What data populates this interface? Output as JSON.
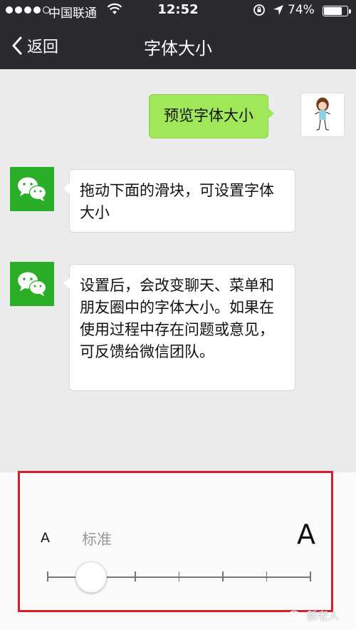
{
  "status_bar": {
    "carrier": "中国联通",
    "time": "12:52",
    "battery_text": "74%",
    "battery_level": 0.74,
    "signal_dots_filled": 4,
    "signal_dots_total": 5
  },
  "nav": {
    "back_label": "返回",
    "title": "字体大小"
  },
  "chat": {
    "messages": [
      {
        "side": "right",
        "text": "预览字体大小",
        "avatar": "user-avatar"
      },
      {
        "side": "left",
        "text": "拖动下面的滑块，可设置字体大小",
        "avatar": "wechat-logo-icon"
      },
      {
        "side": "left",
        "text": "设置后，会改变聊天、菜单和朋友圈中的字体大小。如果在使用过程中存在问题或意见，可反馈给微信团队。",
        "avatar": "wechat-logo-icon"
      }
    ]
  },
  "font_slider": {
    "small_label": "A",
    "large_label": "A",
    "current_label": "标准",
    "steps": 7,
    "selected_index": 1
  },
  "watermark": "新老人",
  "colors": {
    "nav_bg": "#2b2b2f",
    "chat_bg": "#ebebeb",
    "bubble_green": "#a0e75a",
    "wechat_green": "#2bae28",
    "highlight_red": "#d51f2a"
  }
}
